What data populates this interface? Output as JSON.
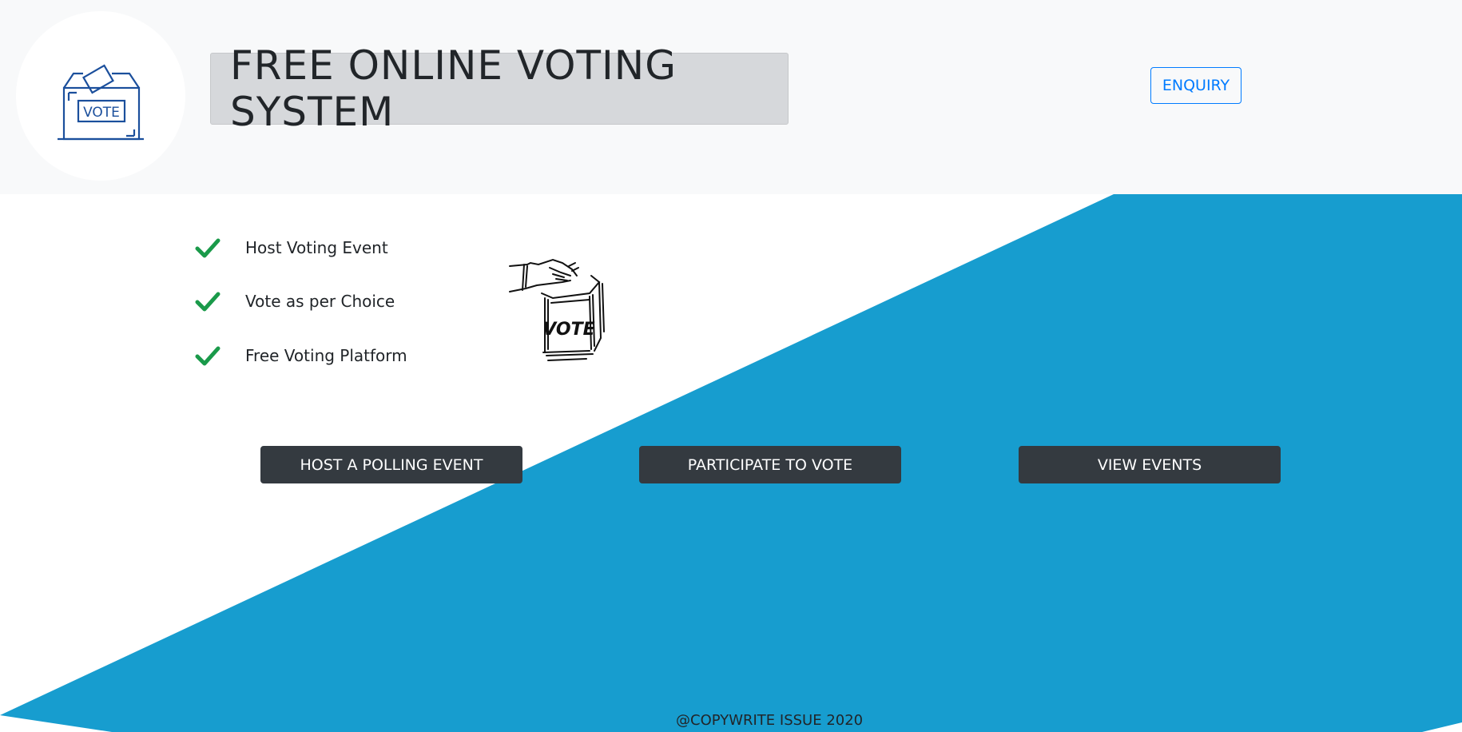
{
  "header": {
    "logo_icon": "vote-box-icon",
    "logo_text": "VOTE",
    "title": "FREE ONLINE VOTING SYSTEM",
    "enquiry_label": "ENQUIRY"
  },
  "features": [
    {
      "label": "Host Voting Event",
      "icon": "check-icon"
    },
    {
      "label": "Vote as per Choice",
      "icon": "check-icon"
    },
    {
      "label": "Free Voting Platform",
      "icon": "check-icon"
    }
  ],
  "illustration": {
    "icon": "hand-voting-sketch",
    "text": "VOTE"
  },
  "actions": {
    "host_label": "HOST A POLLING EVENT",
    "participate_label": "PARTICIPATE TO VOTE",
    "view_label": "VIEW EVENTS"
  },
  "footer": {
    "text": "@COPYWRITE ISSUE 2020"
  },
  "colors": {
    "header_bg": "#f8f9fa",
    "accent_blue": "#179dcf",
    "button_dark": "#343a40",
    "check_green": "#1a9a4a",
    "link_blue": "#007bff"
  }
}
